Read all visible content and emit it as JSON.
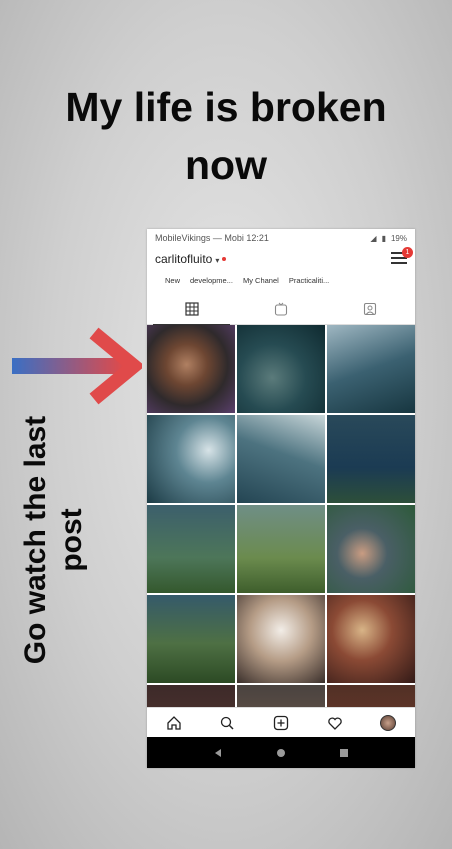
{
  "headline": {
    "line1": "My life is broken",
    "line2": "now"
  },
  "side_text": {
    "line1": "Go watch the last",
    "line2": "post"
  },
  "colors": {
    "arrow_start": "#3a6fc4",
    "arrow_end": "#e04a4a",
    "badge": "#e53935"
  },
  "phone": {
    "status": {
      "carrier": "MobileVikings — Mobi",
      "time": "12:21",
      "battery": "19%"
    },
    "profile": {
      "username": "carlitofluito",
      "menu_badge": "1"
    },
    "highlights": [
      "New",
      "developme...",
      "My Chanel",
      "Practicaliti..."
    ],
    "tabs": [
      "grid-icon",
      "igtv-icon",
      "tagged-icon"
    ],
    "bottom_nav": [
      "home-icon",
      "search-icon",
      "add-post-icon",
      "heart-icon",
      "profile-avatar"
    ],
    "android_nav": [
      "back-icon",
      "home-circle-icon",
      "recents-icon"
    ]
  }
}
